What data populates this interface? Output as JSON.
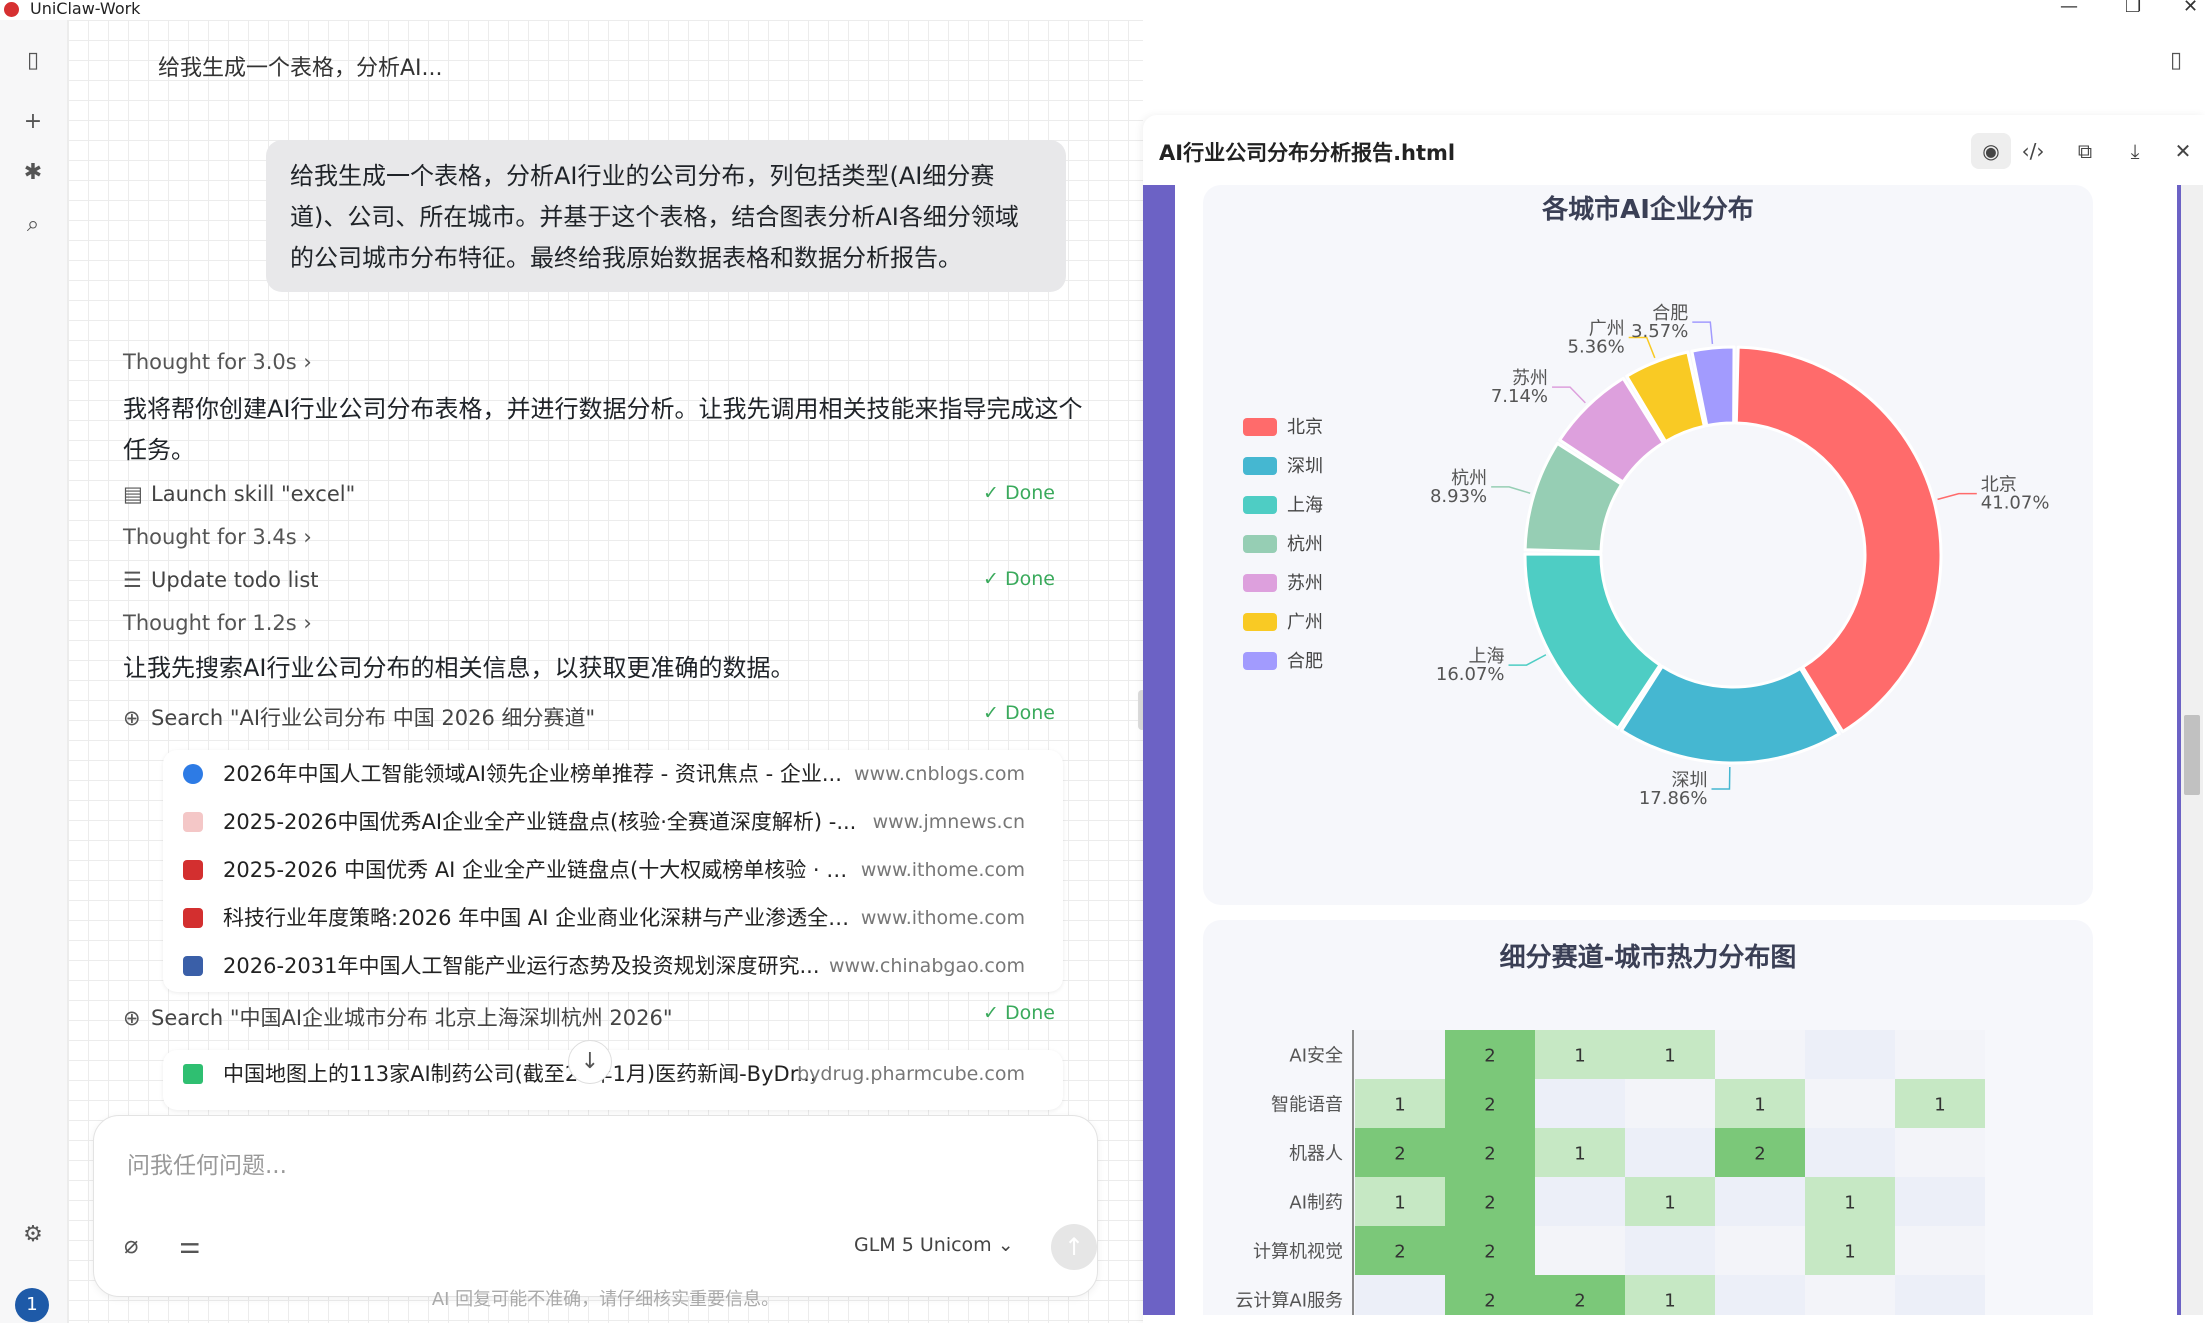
{
  "window": {
    "title": "UniClaw-Work"
  },
  "sidebar": {
    "avatar_initial": "1"
  },
  "chat": {
    "title": "给我生成一个表格，分析AI...",
    "user_message": "给我生成一个表格，分析AI行业的公司分布，列包括类型(AI细分赛道)、公司、所在城市。并基于这个表格，结合图表分析AI各细分领域的公司城市分布特征。最终给我原始数据表格和数据分析报告。",
    "thought1": "Thought for 3.0s",
    "para1": "我将帮你创建AI行业公司分布表格，并进行数据分析。让我先调用相关技能来指导完成这个任务。",
    "tool1": {
      "label": "Launch skill \"excel\"",
      "status": "✓ Done"
    },
    "thought2": "Thought for 3.4s",
    "tool2": {
      "label": "Update todo list",
      "status": "✓ Done"
    },
    "thought3": "Thought for 1.2s",
    "para2": "让我先搜索AI行业公司分布的相关信息，以获取更准确的数据。",
    "search1": {
      "label": "Search \"AI行业公司分布 中国 2026 细分赛道\"",
      "status": "✓ Done",
      "results": [
        {
          "title": "2026年中国人工智能领域AI领先企业榜单推荐 - 资讯焦点 - 企业...",
          "domain": "www.cnblogs.com",
          "color": "#2d7be5"
        },
        {
          "title": "2025-2026中国优秀AI企业全产业链盘点(核验·全赛道深度解析) -...",
          "domain": "www.jmnews.cn",
          "color": "#e05555"
        },
        {
          "title": "2025-2026 中国优秀 AI 企业全产业链盘点(十大权威榜单核验 · 全...",
          "domain": "www.ithome.com",
          "color": "#d32f2f"
        },
        {
          "title": "科技行业年度策略:2026 年中国 AI 企业商业化深耕与产业渗透全景...",
          "domain": "www.ithome.com",
          "color": "#d32f2f"
        },
        {
          "title": "2026-2031年中国人工智能产业运行态势及投资规划深度研究...",
          "domain": "www.chinabgao.com",
          "color": "#3a5fa8"
        }
      ]
    },
    "search2": {
      "label": "Search \"中国AI企业城市分布 北京上海深圳杭州 2026\"",
      "status": "✓ Done",
      "results": [
        {
          "title": "中国地图上的113家AI制药公司(截至26年1月)医药新闻-ByDr...",
          "domain": "bydrug.pharmcube.com",
          "color": "#2fbf71"
        }
      ]
    },
    "composer": {
      "placeholder": "问我任何问题...",
      "model": "GLM 5 Unicom"
    },
    "disclaimer": "AI 回复可能不准确，请仔细核实重要信息。"
  },
  "preview": {
    "filename": "AI行业公司分布分析报告.html",
    "pie_title": "各城市AI企业分布",
    "heat_title": "细分赛道-城市热力分布图"
  },
  "chart_data": [
    {
      "type": "pie",
      "title": "各城市AI企业分布",
      "categories": [
        "北京",
        "深圳",
        "上海",
        "杭州",
        "苏州",
        "广州",
        "合肥"
      ],
      "values": [
        41.07,
        17.86,
        16.07,
        8.93,
        7.14,
        5.36,
        3.57
      ],
      "labels": [
        "41.07%",
        "17.86%",
        "16.07%",
        "8.93%",
        "7.14%",
        "5.36%",
        "3.57%"
      ],
      "colors": [
        "#ff6b6b",
        "#45b7d1",
        "#4ecdc4",
        "#96ceb4",
        "#dda0dd",
        "#f9ca24",
        "#a29bfe"
      ],
      "legend_position": "left"
    },
    {
      "type": "heatmap",
      "title": "细分赛道-城市热力分布图",
      "rows": [
        "AI安全",
        "智能语音",
        "机器人",
        "AI制药",
        "计算机视觉",
        "云计算AI服务"
      ],
      "values": [
        [
          0,
          2,
          1,
          1,
          0,
          0,
          0
        ],
        [
          1,
          2,
          0,
          0,
          1,
          0,
          1
        ],
        [
          2,
          2,
          1,
          0,
          2,
          0,
          0
        ],
        [
          1,
          2,
          0,
          1,
          0,
          1,
          0
        ],
        [
          2,
          2,
          0,
          0,
          0,
          1,
          0
        ],
        [
          0,
          2,
          2,
          1,
          0,
          0,
          0
        ]
      ]
    }
  ]
}
